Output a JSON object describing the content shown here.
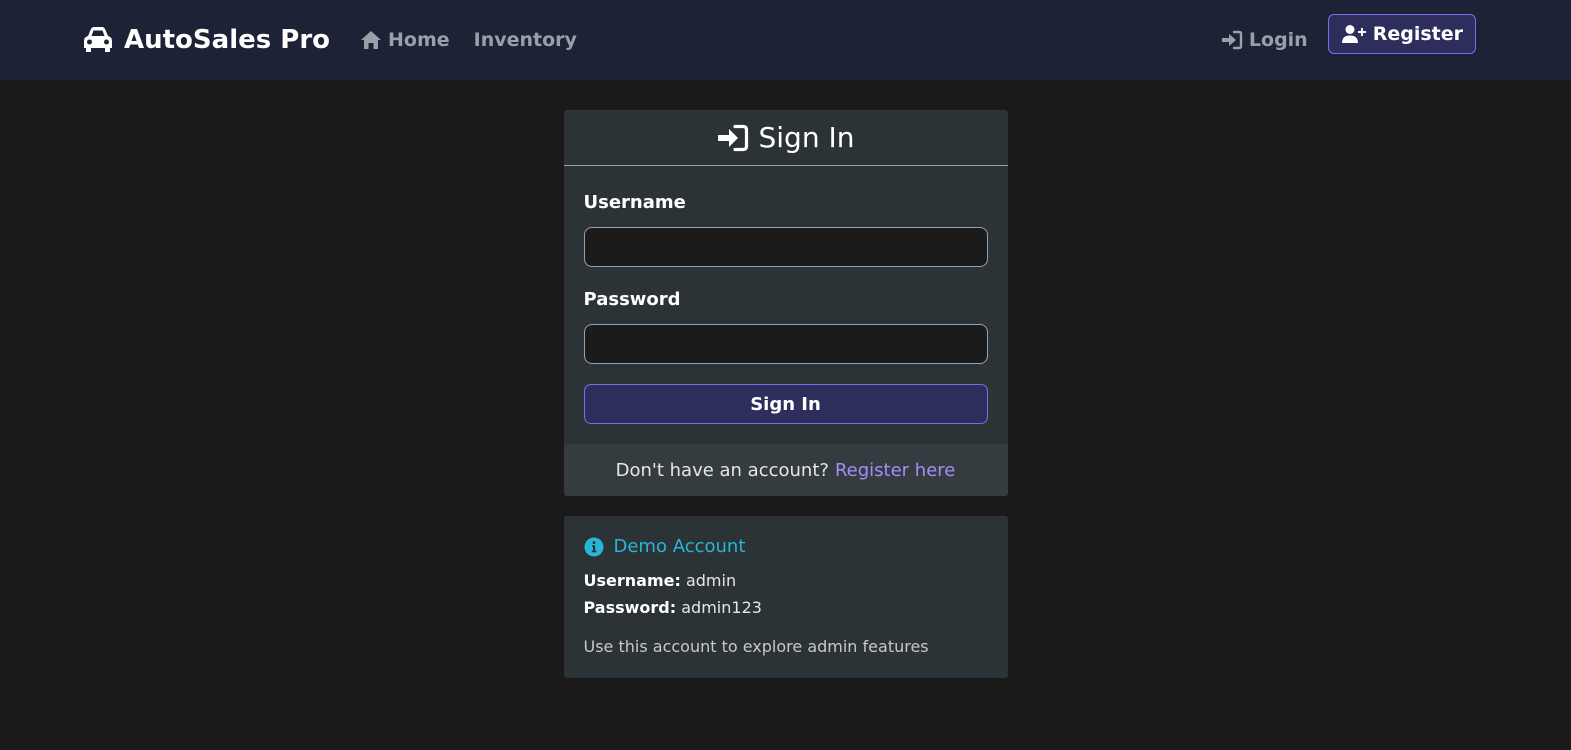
{
  "navbar": {
    "brand": "AutoSales Pro",
    "links": [
      {
        "label": "Home",
        "icon": "home-icon"
      },
      {
        "label": "Inventory"
      }
    ],
    "login_label": "Login",
    "register_label": "Register"
  },
  "signin": {
    "title": "Sign In",
    "username_label": "Username",
    "username_value": "",
    "password_label": "Password",
    "password_value": "",
    "button_label": "Sign In",
    "footer_text": "Don't have an account?",
    "footer_link": "Register here"
  },
  "demo": {
    "title": "Demo Account",
    "username_label": "Username:",
    "username_value": "admin",
    "password_label": "Password:",
    "password_value": "admin123",
    "note": "Use this account to explore admin features"
  },
  "colors": {
    "navbar_bg": "#1d2236",
    "page_bg": "#1a1a1a",
    "card_bg": "#2c3336",
    "accent": "#7a6cf0",
    "link": "#a78bfa",
    "info": "#27b6d9"
  }
}
